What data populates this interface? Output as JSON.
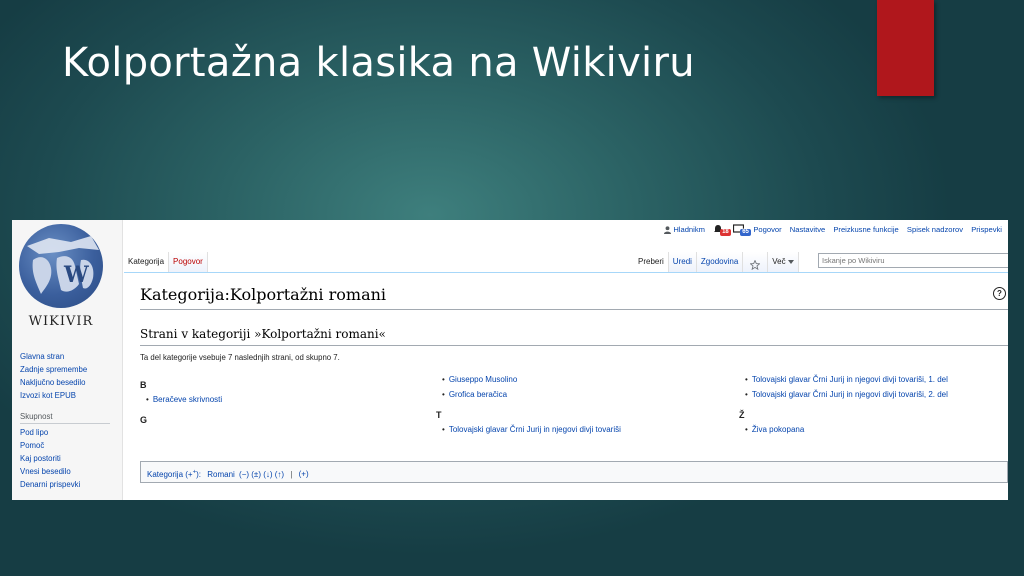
{
  "slide": {
    "title": "Kolportažna klasika na Wikiviru",
    "accent_color": "#b0171c"
  },
  "wiki": {
    "logo_text": "WIKIVIR",
    "nav_main": [
      "Glavna stran",
      "Zadnje spremembe",
      "Naključno besedilo",
      "Izvozi kot EPUB"
    ],
    "nav_heading": "Skupnost",
    "nav_community": [
      "Pod lipo",
      "Pomoč",
      "Kaj postoriti",
      "Vnesi besedilo",
      "Denarni prispevki"
    ],
    "personal": {
      "user": "Hladnikm",
      "notifications": "18",
      "messages": "65",
      "links": [
        "Pogovor",
        "Nastavitve",
        "Preizkusne funkcije",
        "Spisek nadzorov",
        "Prispevki"
      ]
    },
    "tabs_left": [
      "Kategorija",
      "Pogovor"
    ],
    "tabs_right": [
      "Preberi",
      "Uredi",
      "Zgodovina"
    ],
    "more_menu": "Več",
    "search_placeholder": "Iskanje po Wikiviru",
    "page_heading": "Kategorija:Kolportažni romani",
    "sub_heading": "Strani v kategoriji »Kolportažni romani«",
    "summary": "Ta del kategorije vsebuje 7 naslednjih strani, od skupno 7.",
    "columns": [
      {
        "groups": [
          {
            "letter": "B",
            "items": [
              "Beračeve skrivnosti"
            ]
          },
          {
            "letter": "G",
            "items": []
          }
        ]
      },
      {
        "groups": [
          {
            "letter": "",
            "items": [
              "Giuseppo Musolino",
              "Grofica beračica"
            ]
          },
          {
            "letter": "T",
            "items": [
              "Tolovajski glavar Črni Jurij in njegovi divji tovariši"
            ]
          }
        ]
      },
      {
        "groups": [
          {
            "letter": "",
            "items": [
              "Tolovajski glavar Črni Jurij in njegovi divji tovariši, 1. del",
              "Tolovajski glavar Črni Jurij in njegovi divji tovariši, 2. del"
            ]
          },
          {
            "letter": "Ž",
            "items": [
              "Živa pokopana"
            ]
          }
        ]
      }
    ],
    "catlinks": {
      "label": "Kategorija (+",
      "label_sup": "+",
      "label_end": "):",
      "category": "Romani",
      "controls": "(−) (±) (↓) (↑)",
      "separator": "|",
      "add": "(+)"
    }
  }
}
